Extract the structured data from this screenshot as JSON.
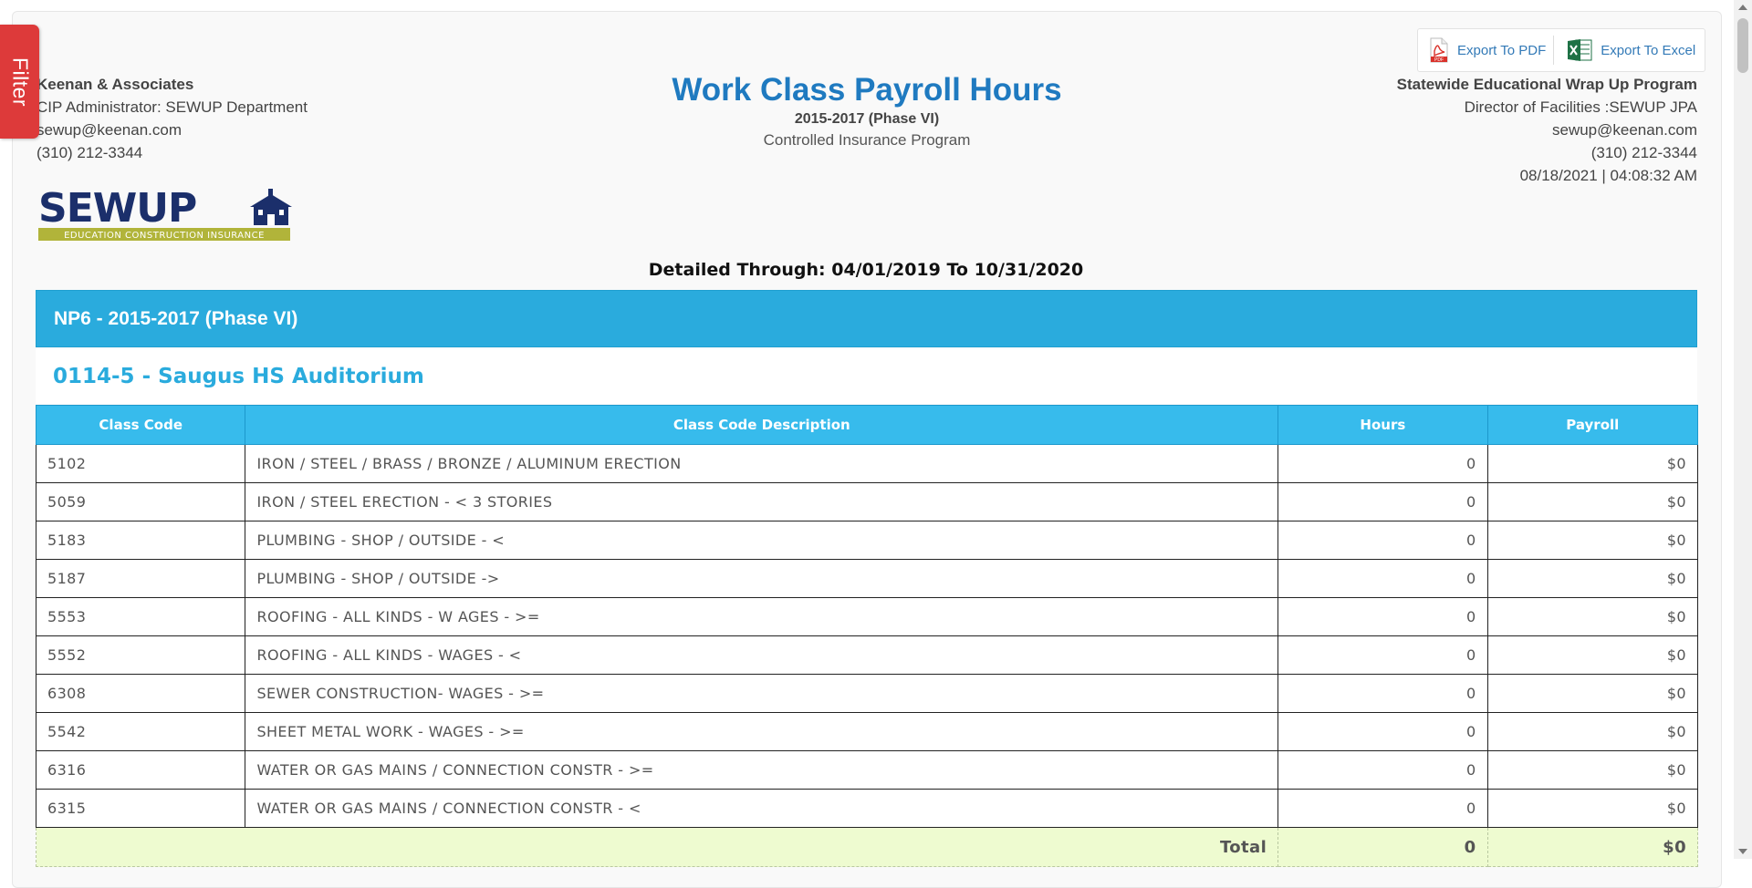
{
  "filter_label": "Filter",
  "export": {
    "pdf_label": "Export To PDF",
    "excel_label": "Export To Excel"
  },
  "left_info": {
    "company": "Keenan & Associates",
    "admin": "CIP Administrator: SEWUP Department",
    "email": "sewup@keenan.com",
    "phone": "(310) 212-3344"
  },
  "header": {
    "title": "Work Class Payroll Hours",
    "phase": "2015-2017 (Phase VI)",
    "subtitle": "Controlled Insurance Program"
  },
  "right_info": {
    "program": "Statewide Educational Wrap Up Program",
    "director": "Director of Facilities :SEWUP JPA",
    "email": "sewup@keenan.com",
    "phone": "(310) 212-3344",
    "datetime": "08/18/2021 | 04:08:32 AM"
  },
  "logo": {
    "text": "SEWUP",
    "tagline": "EDUCATION CONSTRUCTION INSURANCE"
  },
  "detailed_through": "Detailed Through: 04/01/2019 To 10/31/2020",
  "phase_bar": "NP6 - 2015-2017 (Phase VI)",
  "project": "0114-5 - Saugus HS Auditorium",
  "table": {
    "headers": [
      "Class Code",
      "Class Code Description",
      "Hours",
      "Payroll"
    ],
    "rows": [
      {
        "code": "5102",
        "desc": "IRON / STEEL / BRASS / BRONZE / ALUMINUM ERECTION",
        "hours": "0",
        "payroll": "$0"
      },
      {
        "code": "5059",
        "desc": "IRON / STEEL ERECTION - < 3 STORIES",
        "hours": "0",
        "payroll": "$0"
      },
      {
        "code": "5183",
        "desc": "PLUMBING - SHOP / OUTSIDE - <",
        "hours": "0",
        "payroll": "$0"
      },
      {
        "code": "5187",
        "desc": "PLUMBING - SHOP / OUTSIDE ->",
        "hours": "0",
        "payroll": "$0"
      },
      {
        "code": "5553",
        "desc": "ROOFING - ALL KINDS - W AGES - >=",
        "hours": "0",
        "payroll": "$0"
      },
      {
        "code": "5552",
        "desc": "ROOFING - ALL KINDS - WAGES - <",
        "hours": "0",
        "payroll": "$0"
      },
      {
        "code": "6308",
        "desc": "SEWER CONSTRUCTION- WAGES - >=",
        "hours": "0",
        "payroll": "$0"
      },
      {
        "code": "5542",
        "desc": "SHEET METAL WORK - WAGES - >=",
        "hours": "0",
        "payroll": "$0"
      },
      {
        "code": "6316",
        "desc": "WATER OR GAS MAINS / CONNECTION CONSTR - >=",
        "hours": "0",
        "payroll": "$0"
      },
      {
        "code": "6315",
        "desc": "WATER OR GAS MAINS / CONNECTION CONSTR - <",
        "hours": "0",
        "payroll": "$0"
      }
    ],
    "total": {
      "label": "Total",
      "hours": "0",
      "payroll": "$0"
    }
  },
  "colors": {
    "title": "#1f7ac0",
    "phase_bar": "#2aabdd",
    "table_header": "#37bbec",
    "filter": "#dd3a3a",
    "total_bg": "#eefbd0"
  },
  "icons": [
    "pdf-icon",
    "excel-icon",
    "school-icon"
  ]
}
